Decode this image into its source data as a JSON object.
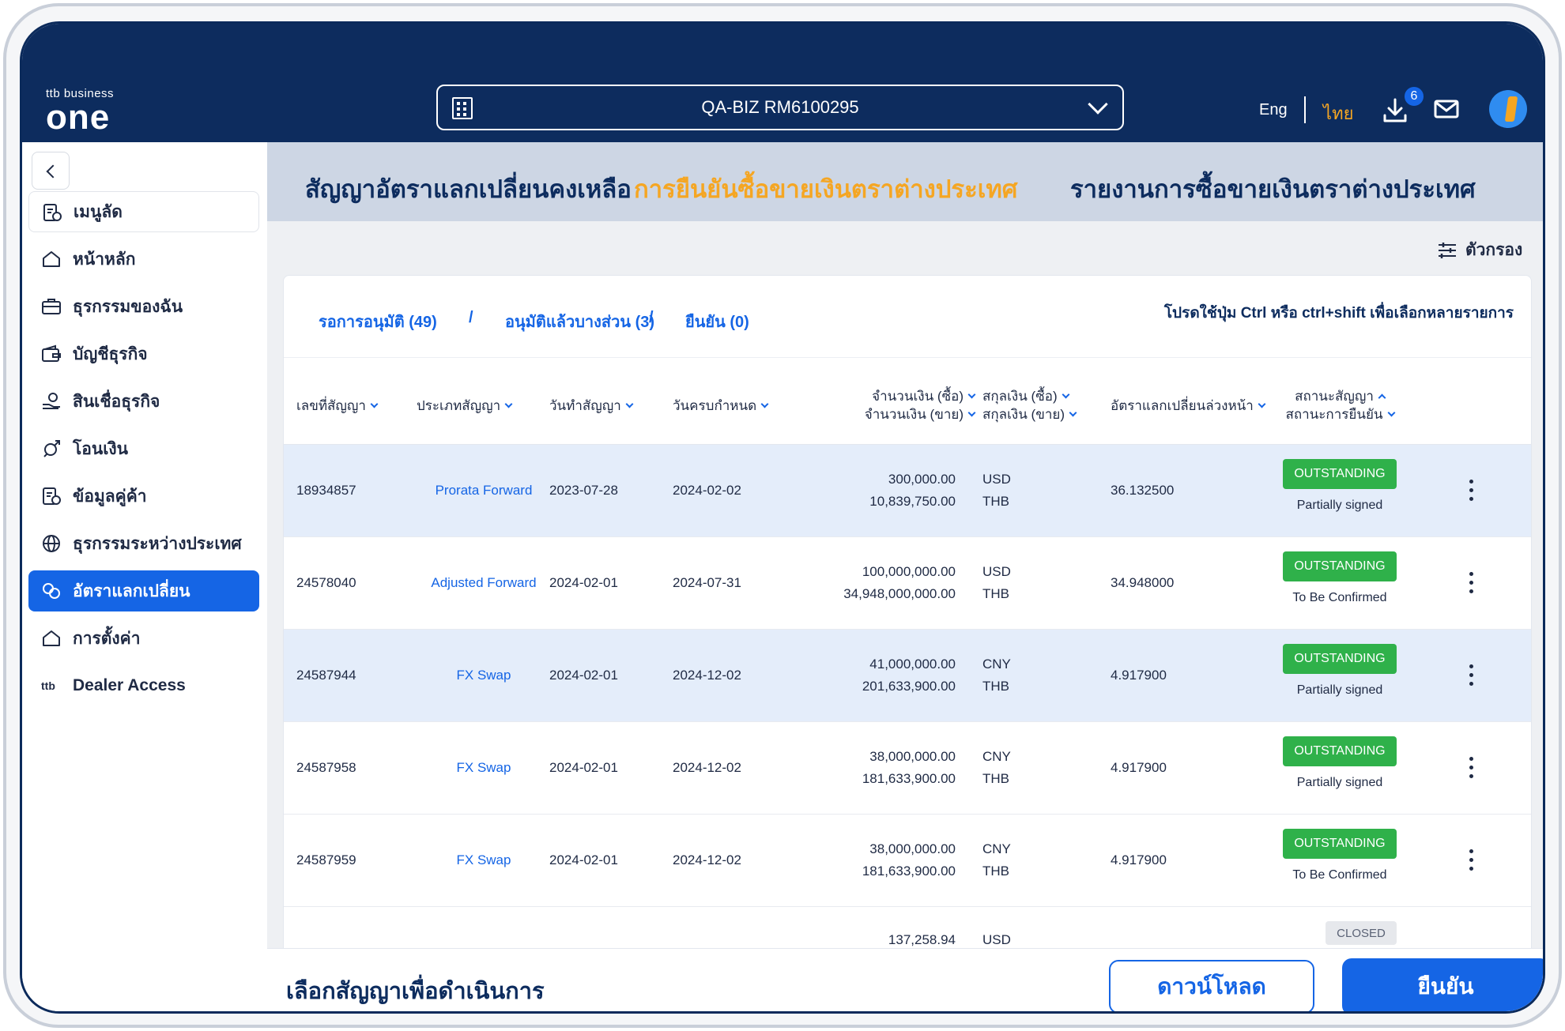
{
  "header": {
    "logo_small": "ttb business",
    "logo_big": "one",
    "account": "QA-BIZ RM6100295",
    "lang_en": "Eng",
    "lang_th": "ไทย",
    "download_count": "6"
  },
  "sidebar": {
    "items": [
      {
        "label": "เมนูลัด",
        "icon": "shortcut-icon"
      },
      {
        "label": "หน้าหลัก",
        "icon": "home-icon"
      },
      {
        "label": "ธุรกรรมของฉัน",
        "icon": "briefcase-icon"
      },
      {
        "label": "บัญชีธุรกิจ",
        "icon": "wallet-icon"
      },
      {
        "label": "สินเชื่อธุรกิจ",
        "icon": "loan-icon"
      },
      {
        "label": "โอนเงิน",
        "icon": "transfer-icon"
      },
      {
        "label": "ข้อมูลคู่ค้า",
        "icon": "partner-icon"
      },
      {
        "label": "ธุรกรรมระหว่างประเทศ",
        "icon": "globe-icon"
      },
      {
        "label": "อัตราแลกเปลี่ยน",
        "icon": "exchange-icon"
      },
      {
        "label": "การตั้งค่า",
        "icon": "settings-icon"
      },
      {
        "label": "Dealer Access",
        "icon": "ttb-icon"
      }
    ]
  },
  "tabs": [
    {
      "label": "สัญญาอัตราแลกเปลี่ยนคงเหลือ"
    },
    {
      "label": "การยืนยันซื้อขายเงินตราต่างประเทศ"
    },
    {
      "label": "รายงานการซื้อขายเงินตราต่างประเทศ"
    }
  ],
  "filter_label": "ตัวกรอง",
  "subtabs": {
    "pending": "รอการอนุมัติ (49)",
    "partial": "อนุมัติแล้วบางส่วน (3)",
    "confirmed": "ยืนยัน (0)",
    "separator": "/",
    "hint": "โปรดใช้ปุ่ม Ctrl หรือ ctrl+shift เพื่อเลือกหลายรายการ"
  },
  "columns": {
    "contract_no": "เลขที่สัญญา",
    "contract_type": "ประเภทสัญญา",
    "contract_date": "วันทำสัญญา",
    "due_date": "วันครบกำหนด",
    "amount_buy": "จำนวนเงิน (ซื้อ)",
    "amount_sell": "จำนวนเงิน (ขาย)",
    "ccy_buy": "สกุลเงิน (ซื้อ)",
    "ccy_sell": "สกุลเงิน (ขาย)",
    "forward_rate": "อัตราแลกเปลี่ยนล่วงหน้า",
    "contract_status": "สถานะสัญญา",
    "confirm_status": "สถานะการยืนยัน"
  },
  "rows": [
    {
      "no": "18934857",
      "type": "Prorata Forward",
      "date": "2023-07-28",
      "due": "2024-02-02",
      "buy": "300,000.00",
      "sell": "10,839,750.00",
      "ccy1": "USD",
      "ccy2": "THB",
      "rate": "36.132500",
      "status": "OUTSTANDING",
      "sign": "Partially signed"
    },
    {
      "no": "24578040",
      "type": "Adjusted Forward",
      "date": "2024-02-01",
      "due": "2024-07-31",
      "buy": "100,000,000.00",
      "sell": "34,948,000,000.00",
      "ccy1": "USD",
      "ccy2": "THB",
      "rate": "34.948000",
      "status": "OUTSTANDING",
      "sign": "To Be Confirmed"
    },
    {
      "no": "24587944",
      "type": "FX Swap",
      "date": "2024-02-01",
      "due": "2024-12-02",
      "buy": "41,000,000.00",
      "sell": "201,633,900.00",
      "ccy1": "CNY",
      "ccy2": "THB",
      "rate": "4.917900",
      "status": "OUTSTANDING",
      "sign": "Partially signed"
    },
    {
      "no": "24587958",
      "type": "FX Swap",
      "date": "2024-02-01",
      "due": "2024-12-02",
      "buy": "38,000,000.00",
      "sell": "181,633,900.00",
      "ccy1": "CNY",
      "ccy2": "THB",
      "rate": "4.917900",
      "status": "OUTSTANDING",
      "sign": "Partially signed"
    },
    {
      "no": "24587959",
      "type": "FX Swap",
      "date": "2024-02-01",
      "due": "2024-12-02",
      "buy": "38,000,000.00",
      "sell": "181,633,900.00",
      "ccy1": "CNY",
      "ccy2": "THB",
      "rate": "4.917900",
      "status": "OUTSTANDING",
      "sign": "To Be Confirmed"
    },
    {
      "no": "",
      "type": "",
      "date": "",
      "due": "",
      "buy": "137,258.94",
      "sell": "",
      "ccy1": "USD",
      "ccy2": "",
      "rate": "",
      "status": "CLOSED",
      "sign": ""
    }
  ],
  "footer": {
    "title": "เลือกสัญญาเพื่อดำเนินการ",
    "download": "ดาวน์โหลด",
    "confirm": "ยืนยัน"
  },
  "colors": {
    "navy": "#0d2c5e",
    "primary": "#1565e5",
    "accent": "#f5a623",
    "success": "#2fb14a"
  }
}
